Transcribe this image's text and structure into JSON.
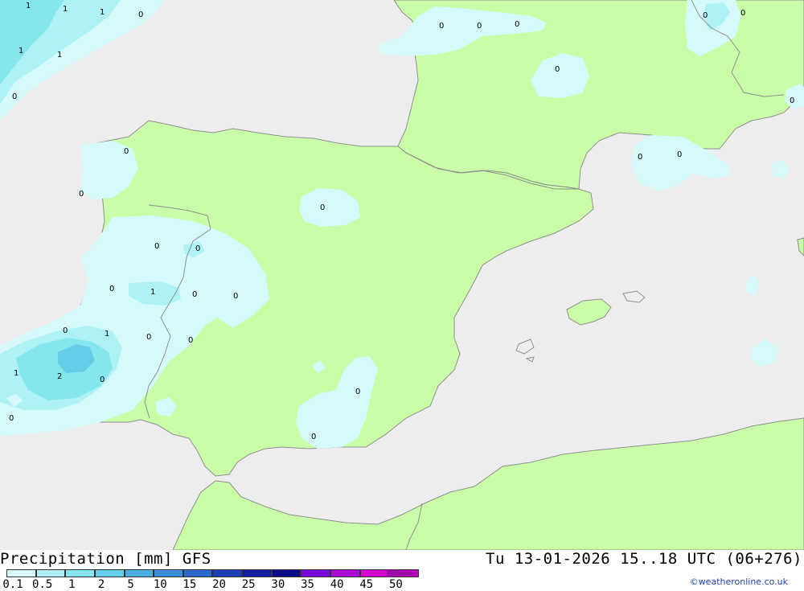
{
  "title": "Precipitation [mm] GFS",
  "datetime": "Tu 13-01-2026 15..18 UTC (06+276)",
  "credit": "©weatheronline.co.uk",
  "colors": {
    "sea": "#ededed",
    "land": "#c9fda7",
    "coast": "#8f8f8f",
    "level_01": "#d6fafc",
    "level_05": "#aef2f5",
    "level_1": "#86e6ee",
    "level_2": "#64cde8"
  },
  "scale": [
    {
      "label": "0.1",
      "color": "#d6fafc"
    },
    {
      "label": "0.5",
      "color": "#aef2f5"
    },
    {
      "label": "1",
      "color": "#86e6ee"
    },
    {
      "label": "2",
      "color": "#64cde8"
    },
    {
      "label": "5",
      "color": "#4ab0e2"
    },
    {
      "label": "10",
      "color": "#3a8fd8"
    },
    {
      "label": "15",
      "color": "#2c68cc"
    },
    {
      "label": "20",
      "color": "#1e3fb8"
    },
    {
      "label": "25",
      "color": "#131ea0"
    },
    {
      "label": "30",
      "color": "#0c0c88"
    },
    {
      "label": "35",
      "color": "#7a0bd8"
    },
    {
      "label": "40",
      "color": "#a90ad8"
    },
    {
      "label": "45",
      "color": "#d40ad0"
    },
    {
      "label": "50",
      "color": "#b90ab8"
    }
  ],
  "map_values": [
    "1",
    "1",
    "1",
    "0",
    "1",
    "1",
    "0",
    "0",
    "0",
    "0",
    "0",
    "0",
    "0",
    "0",
    "0",
    "0",
    "0",
    "0",
    "0",
    "0",
    "0",
    "1",
    "0",
    "0",
    "0",
    "1",
    "0",
    "0",
    "1",
    "2",
    "0",
    "0",
    "0",
    "0",
    "0",
    "0"
  ]
}
